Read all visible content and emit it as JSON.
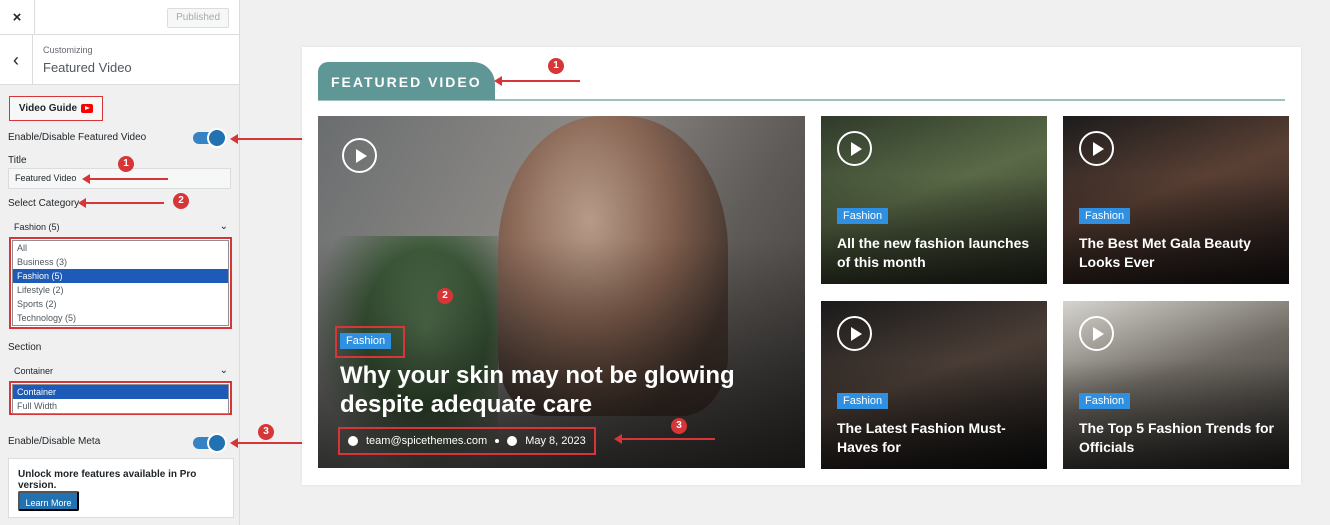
{
  "topbar": {
    "close_icon": "×",
    "published_label": "Published"
  },
  "section": {
    "breadcrumb": "Customizing",
    "title": "Featured Video",
    "back_icon": "‹"
  },
  "panel": {
    "video_guide_label": "Video Guide",
    "enable_video_label": "Enable/Disable Featured Video",
    "title_label": "Title",
    "title_value": "Featured Video",
    "category_label": "Select Category",
    "category_selected": "Fashion  (5)",
    "category_options": [
      "All",
      "Business  (3)",
      "Fashion  (5)",
      "Lifestyle  (2)",
      "Sports  (2)",
      "Technology  (5)"
    ],
    "section_label": "Section",
    "section_selected": "Container",
    "section_options": [
      "Container",
      "Full Width"
    ],
    "enable_meta_label": "Enable/Disable Meta",
    "pro_text": "Unlock more features available in Pro version.",
    "learn_more_label": "Learn More",
    "chevron": "⌄"
  },
  "preview": {
    "heading": "FEATURED VIDEO",
    "main": {
      "badge": "Fashion",
      "title": "Why your skin may not be glowing despite adequate care",
      "author": "team@spicethemes.com",
      "date": "May 8, 2023"
    },
    "cards": [
      {
        "badge": "Fashion",
        "title": "All the new fashion launches of this month"
      },
      {
        "badge": "Fashion",
        "title": "The Best Met Gala Beauty Looks Ever"
      },
      {
        "badge": "Fashion",
        "title": "The Latest Fashion Must-Haves for"
      },
      {
        "badge": "Fashion",
        "title": "The Top 5 Fashion Trends for Officials"
      }
    ]
  },
  "annotations": {
    "n1": "1",
    "n2": "2",
    "n3": "3"
  },
  "colors": {
    "accent": "#2271b1",
    "annotation": "#d63638",
    "heading_tab": "#5e9796",
    "badge": "#2f8fe0"
  }
}
